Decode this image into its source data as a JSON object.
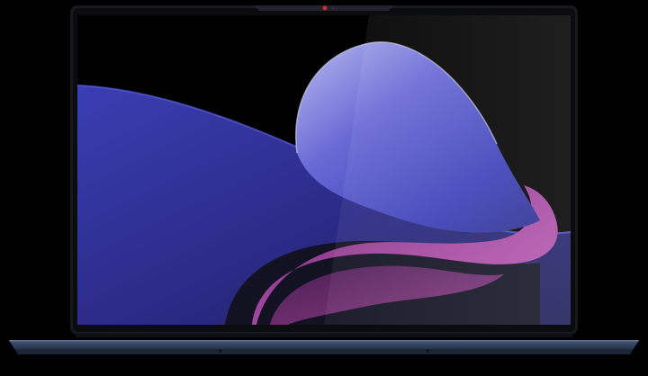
{
  "product": {
    "kind": "laptop-front-view",
    "body_color": "#3a4b66",
    "bezel_color": "#0b0c10",
    "camera_light_color": "#e2262b"
  },
  "screen": {
    "wallpaper": "abstract-blue-purple-waves",
    "colors": {
      "background": "#000000",
      "blue": "#3b3ea8",
      "violet": "#6a5ccf",
      "magenta": "#a4479e",
      "lavender": "#c7c9ee"
    }
  }
}
